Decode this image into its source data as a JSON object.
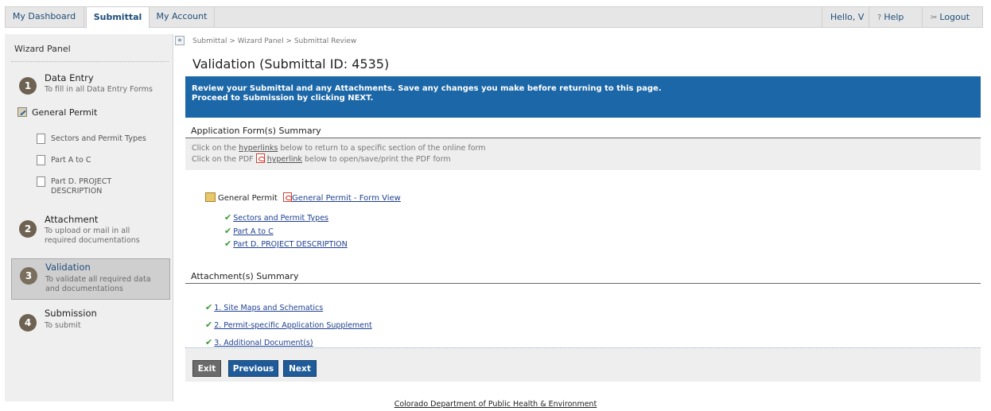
{
  "nav": {
    "tabs": [
      {
        "label": "My Dashboard"
      },
      {
        "label": "Submittal"
      },
      {
        "label": "My Account"
      }
    ],
    "greeting": "Hello, V",
    "help_label": "Help",
    "logout_label": "Logout",
    "help_icon": "help-icon",
    "logout_icon": "logout-icon"
  },
  "sidebar": {
    "title": "Wizard Panel",
    "steps": [
      {
        "number": "1",
        "title": "Data Entry",
        "desc": "To fill in all Data Entry Forms"
      },
      {
        "number": "2",
        "title": "Attachment",
        "desc": "To upload or mail in all required documentations"
      },
      {
        "number": "3",
        "title": "Validation",
        "desc": "To validate all required data and documentations"
      },
      {
        "number": "4",
        "title": "Submission",
        "desc": "To submit"
      }
    ],
    "general_permit": "General Permit",
    "forms": [
      {
        "label": "Sectors and Permit Types"
      },
      {
        "label": "Part A to C"
      },
      {
        "label": "Part D. PROJECT DESCRIPTION"
      }
    ],
    "collapse_glyph": "«"
  },
  "main": {
    "breadcrumb": "Submittal > Wizard Panel > Submittal Review",
    "title": "Validation (Submittal ID: 4535)",
    "banner_line1": "Review your Submittal and any Attachments. Save any changes you make before returning to this page.",
    "banner_line2": "Proceed to Submission by clicking NEXT.",
    "app_summary_heading": "Application Form(s) Summary",
    "instr1_pre": "Click on the ",
    "instr1_link": "hyperlinks",
    "instr1_post": " below to return to a specific section of the online form",
    "instr2_pre": "Click on the PDF ",
    "instr2_link": "hyperlink",
    "instr2_post": " below to open/save/print the PDF form",
    "form_name": "General Permit",
    "form_view_link": "General Permit - Form View",
    "form_links": [
      {
        "label": "Sectors and Permit Types"
      },
      {
        "label": "Part A to C"
      },
      {
        "label": "Part D. PROJECT DESCRIPTION"
      }
    ],
    "attach_heading": "Attachment(s) Summary",
    "attachments": [
      {
        "label": "1. Site Maps and Schematics"
      },
      {
        "label": "2. Permit-specific Application Supplement"
      },
      {
        "label": "3. Additional Document(s)"
      }
    ],
    "buttons": {
      "exit": "Exit",
      "previous": "Previous",
      "next": "Next"
    }
  },
  "footer": {
    "text": "Colorado Department of Public Health & Environment"
  }
}
